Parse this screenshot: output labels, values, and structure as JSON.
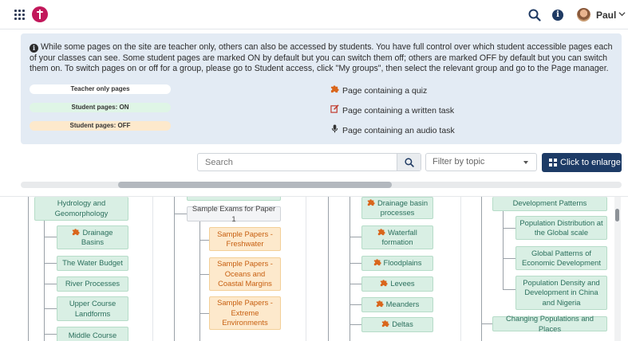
{
  "header": {
    "user_name": "Paul",
    "icons": [
      "apps-grid-icon",
      "site-logo",
      "search-icon",
      "info-icon",
      "avatar",
      "chevron-down-icon"
    ]
  },
  "info": {
    "text": "While some pages on the site are teacher only, others can also be accessed by students. You have full control over which student accessible pages each of your classes can see. Some student pages are marked ON by default but you can switch them off; others are marked OFF by default but you can switch them on. To switch pages on or off for a group, please go to Student access, click \"My groups\", then select the relevant group and go to the Page manager.",
    "pills": {
      "teacher_only": "Teacher only pages",
      "student_on": "Student pages: ON",
      "student_off": "Student pages: OFF"
    },
    "legend": {
      "quiz": "Page containing a quiz",
      "written": "Page containing a written task",
      "audio": "Page containing an audio task"
    }
  },
  "toolbar": {
    "search_placeholder": "Search",
    "filter_placeholder": "Filter by topic",
    "enlarge_label": "Click to enlarge"
  },
  "scroll": {
    "horizontal_visible_fraction": 0.46
  },
  "tree": {
    "col1": {
      "parent": "Hydrology and Geomorphology",
      "children": [
        "Drainage Basins",
        "The Water Budget",
        "River Processes",
        "Upper Course Landforms",
        "Middle Course"
      ]
    },
    "col2": {
      "group": "Sample Exams for Paper 1",
      "children": [
        "Sample Papers - Freshwater",
        "Sample Papers - Oceans and Coastal Margins",
        "Sample Papers - Extreme Environments"
      ]
    },
    "col3": {
      "children": [
        "Drainage basin processes",
        "Waterfall formation",
        "Floodplains",
        "Levees",
        "Meanders",
        "Deltas"
      ]
    },
    "col4": {
      "parent": "Development Patterns",
      "children": [
        "Population Distribution at the Global scale",
        "Global Patterns of Economic Development",
        "Population Density and Development in China and Nigeria"
      ],
      "next": "Changing Populations and Places"
    }
  },
  "colors": {
    "accent": "#1d3b66",
    "panel": "#e3ebf4",
    "on": "#d9efe4",
    "off": "#fde9cc",
    "puzzle": "#d9661c"
  }
}
